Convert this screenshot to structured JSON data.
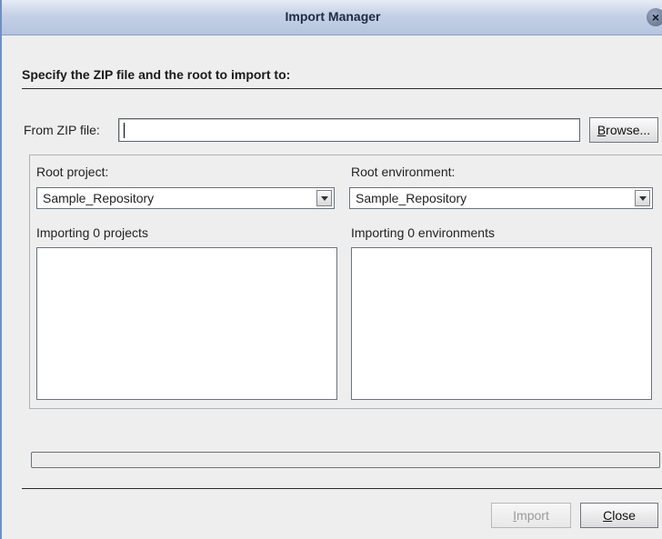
{
  "window": {
    "title": "Import Manager"
  },
  "heading": "Specify the ZIP file and the root to import to:",
  "zip": {
    "label": "From ZIP file:",
    "value": "",
    "browse_label_prefix": "B",
    "browse_label_rest": "rowse..."
  },
  "root_project": {
    "label": "Root project:",
    "selected": "Sample_Repository",
    "list_label": "Importing 0 projects"
  },
  "root_environment": {
    "label": "Root environment:",
    "selected": "Sample_Repository",
    "list_label": "Importing 0 environments"
  },
  "progress": {
    "value": 0
  },
  "buttons": {
    "import_prefix": "I",
    "import_rest": "mport",
    "close_prefix": "C",
    "close_rest": "lose"
  }
}
